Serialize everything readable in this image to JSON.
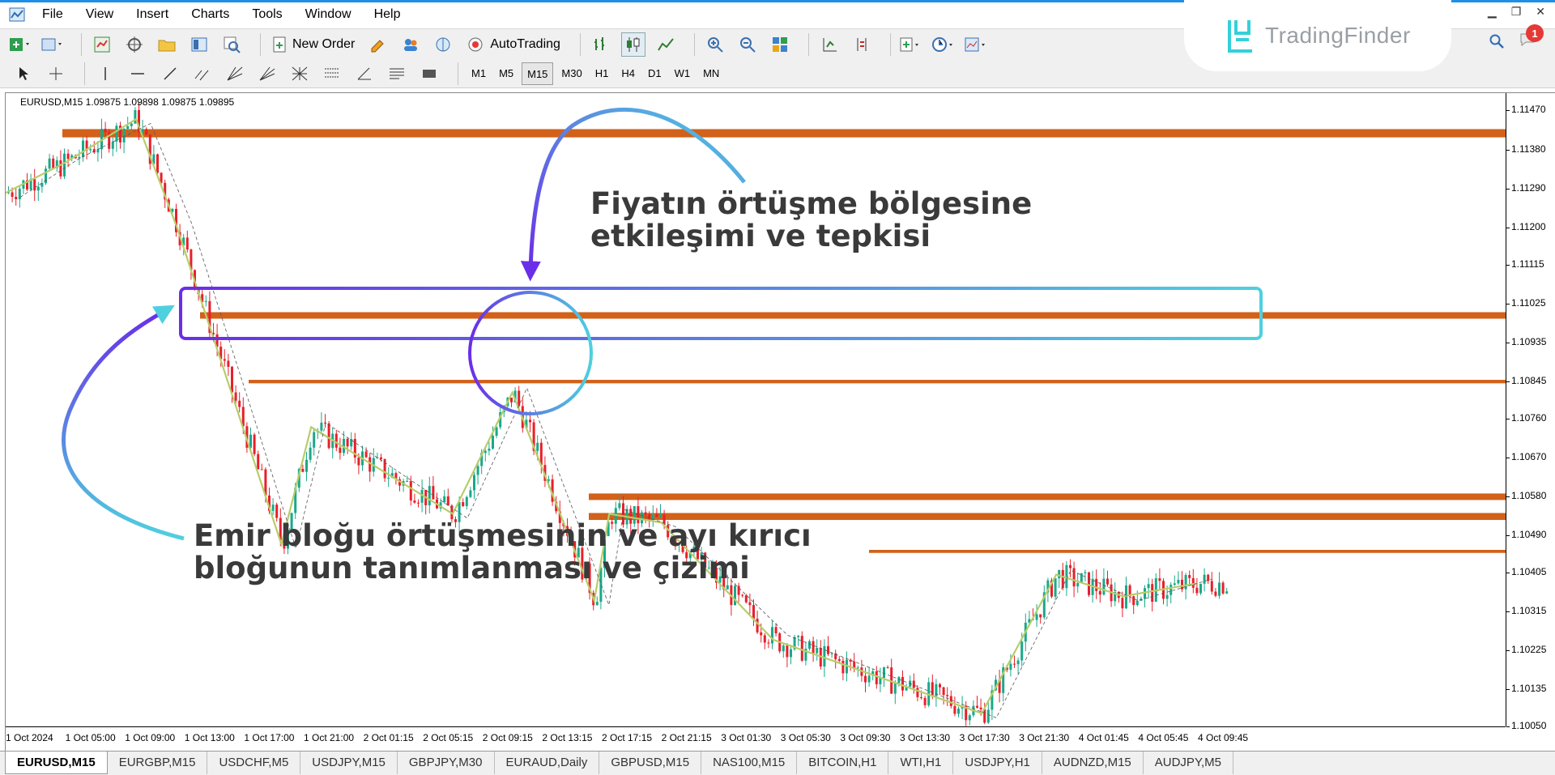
{
  "menu": [
    "File",
    "View",
    "Insert",
    "Charts",
    "Tools",
    "Window",
    "Help"
  ],
  "toolbar": {
    "new_order": "New Order",
    "autotrading": "AutoTrading"
  },
  "timeframes": [
    "M1",
    "M5",
    "M15",
    "M30",
    "H1",
    "H4",
    "D1",
    "W1",
    "MN"
  ],
  "active_timeframe": "M15",
  "brand": {
    "name": "TradingFinder",
    "accent": "#33d1d8"
  },
  "notifications": "1",
  "chart": {
    "header": "EURUSD,M15  1.09875 1.09898 1.09875 1.09895",
    "price_labels": [
      "1.11470",
      "1.11380",
      "1.11290",
      "1.11200",
      "1.11115",
      "1.11025",
      "1.10935",
      "1.10845",
      "1.10760",
      "1.10670",
      "1.10580",
      "1.10490",
      "1.10405",
      "1.10315",
      "1.10225",
      "1.10135",
      "1.10050"
    ],
    "time_labels": [
      "1 Oct 2024",
      "1 Oct 05:00",
      "1 Oct 09:00",
      "1 Oct 13:00",
      "1 Oct 17:00",
      "1 Oct 21:00",
      "2 Oct 01:15",
      "2 Oct 05:15",
      "2 Oct 09:15",
      "2 Oct 13:15",
      "2 Oct 17:15",
      "2 Oct 21:15",
      "3 Oct 01:30",
      "3 Oct 05:30",
      "3 Oct 09:30",
      "3 Oct 13:30",
      "3 Oct 17:30",
      "3 Oct 21:30",
      "4 Oct 01:45",
      "4 Oct 05:45",
      "4 Oct 09:45"
    ],
    "colors": {
      "bull": "#1aa88a",
      "bear": "#e8202a",
      "zigzag": "#b7cd6b",
      "zone": "#d2611a"
    }
  },
  "chart_data": {
    "type": "candlestick",
    "symbol": "EURUSD",
    "timeframe": "M15",
    "ylim": [
      1.1005,
      1.1151
    ],
    "zigzag": [
      {
        "t": "1 Oct 00:00",
        "p": 1.1128
      },
      {
        "t": "1 Oct 04:00",
        "p": 1.1135
      },
      {
        "t": "1 Oct 08:45",
        "p": 1.1145
      },
      {
        "t": "1 Oct 11:30",
        "p": 1.112
      },
      {
        "t": "1 Oct 18:30",
        "p": 1.1047
      },
      {
        "t": "1 Oct 20:30",
        "p": 1.1074
      },
      {
        "t": "2 Oct 06:00",
        "p": 1.1054
      },
      {
        "t": "2 Oct 10:00",
        "p": 1.1082
      },
      {
        "t": "2 Oct 15:30",
        "p": 1.1034
      },
      {
        "t": "2 Oct 16:30",
        "p": 1.1054
      },
      {
        "t": "2 Oct 20:00",
        "p": 1.1052
      },
      {
        "t": "3 Oct 03:30",
        "p": 1.1025
      },
      {
        "t": "3 Oct 17:30",
        "p": 1.1008
      },
      {
        "t": "3 Oct 22:30",
        "p": 1.104
      },
      {
        "t": "4 Oct 03:00",
        "p": 1.1035
      },
      {
        "t": "4 Oct 08:00",
        "p": 1.1038
      }
    ],
    "zones": [
      {
        "from": 1.11408,
        "to": 1.11427
      },
      {
        "from": 1.1099,
        "to": 1.11005
      },
      {
        "from": 1.10841,
        "to": 1.10849
      },
      {
        "from": 1.10572,
        "to": 1.10587
      },
      {
        "from": 1.10526,
        "to": 1.10542
      },
      {
        "from": 1.1045,
        "to": 1.10457
      }
    ],
    "annotations": [
      "Fiyatın örtüşme bölgesine etkileşimi ve tepkisi",
      "Emir bloğu örtüşmesinin ve ayı kırıcı bloğunun tanımlanması ve çizimi"
    ]
  },
  "annotations": {
    "top_line1": "Fiyatın örtüşme bölgesine",
    "top_line2": "etkileşimi ve tepkisi",
    "bottom_line1": "Emir bloğu örtüşmesinin ve ayı kırıcı",
    "bottom_line2": "bloğunun tanımlanması ve çizimi"
  },
  "tabs": [
    "EURUSD,M15",
    "EURGBP,M15",
    "USDCHF,M5",
    "USDJPY,M15",
    "GBPJPY,M30",
    "EURAUD,Daily",
    "GBPUSD,M15",
    "NAS100,M15",
    "BITCOIN,H1",
    "WTI,H1",
    "USDJPY,H1",
    "AUDNZD,M15",
    "AUDJPY,M5"
  ]
}
